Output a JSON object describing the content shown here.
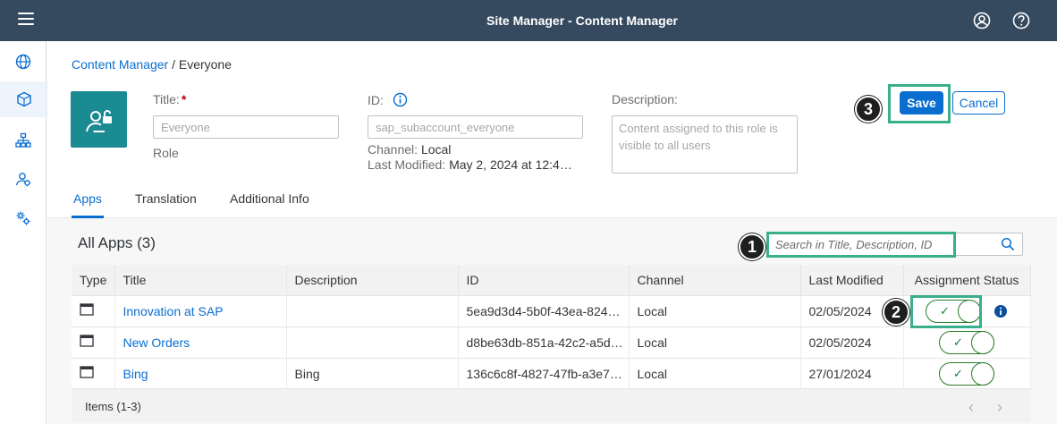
{
  "shell": {
    "title": "Site Manager - Content Manager"
  },
  "breadcrumb": {
    "link": "Content Manager",
    "separator": " / ",
    "current": "Everyone"
  },
  "header": {
    "title_label": "Title:",
    "required_mark": "*",
    "title_value": "Everyone",
    "type": "Role",
    "id_label": "ID:",
    "id_value": "sap_subaccount_everyone",
    "channel_label": "Channel:",
    "channel_value": "Local",
    "modified_label": "Last Modified:",
    "modified_value": "May 2, 2024 at 12:4…",
    "description_label": "Description:",
    "description_value": "Content assigned to this role is visible to all users",
    "save": "Save",
    "cancel": "Cancel"
  },
  "callouts": {
    "one": "1",
    "two": "2",
    "three": "3"
  },
  "tabs": [
    {
      "label": "Apps"
    },
    {
      "label": "Translation"
    },
    {
      "label": "Additional Info"
    }
  ],
  "apps": {
    "title": "All Apps (3)",
    "search_placeholder": "Search in Title, Description, ID",
    "columns": [
      "Type",
      "Title",
      "Description",
      "ID",
      "Channel",
      "Last Modified",
      "Assignment Status"
    ],
    "rows": [
      {
        "title": "Innovation at SAP",
        "description": "",
        "id": "5ea9d3d4-5b0f-43ea-824…",
        "channel": "Local",
        "modified": "02/05/2024"
      },
      {
        "title": "New Orders",
        "description": "",
        "id": "d8be63db-851a-42c2-a5d…",
        "channel": "Local",
        "modified": "02/05/2024"
      },
      {
        "title": "Bing",
        "description": "Bing",
        "id": "136c6c8f-4827-47fb-a3e7…",
        "channel": "Local",
        "modified": "27/01/2024"
      }
    ],
    "footer": "Items (1-3)"
  },
  "colors": {
    "shell": "#354a5f",
    "accent": "#0a6ed1",
    "highlight": "#3aaf8b",
    "avatar": "#1a8a93",
    "toggle_on": "#107e3e"
  },
  "icons": [
    "menu-icon",
    "user-icon",
    "help-icon",
    "globe-icon",
    "package-icon",
    "hierarchy-icon",
    "user-role-icon",
    "settings-icon",
    "role-avatar-icon",
    "info-icon",
    "search-icon",
    "app-window-icon",
    "check-icon",
    "chevron-left-icon",
    "chevron-right-icon"
  ]
}
